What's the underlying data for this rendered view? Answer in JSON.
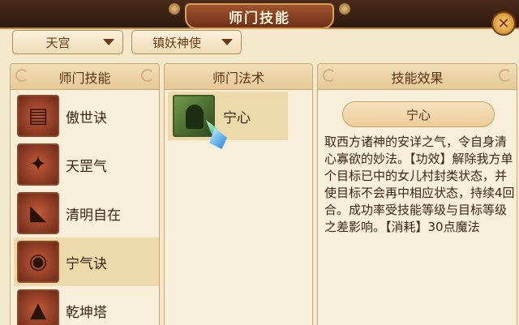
{
  "window": {
    "title": "师门技能",
    "close_glyph": "✕"
  },
  "filters": {
    "sect": "天宫",
    "master": "镇妖神使"
  },
  "panels": {
    "skills": {
      "header": "师门技能",
      "items": [
        {
          "name": "傲世诀",
          "icon": "scroll-icon",
          "glyph": "▤"
        },
        {
          "name": "天罡气",
          "icon": "warrior-icon",
          "glyph": "✦"
        },
        {
          "name": "清明自在",
          "icon": "horn-icon",
          "glyph": "◣"
        },
        {
          "name": "宁气诀",
          "icon": "orb-icon",
          "glyph": "◉"
        },
        {
          "name": "乾坤塔",
          "icon": "tower-icon",
          "glyph": "▲"
        }
      ],
      "selected_index": 3
    },
    "spells": {
      "header": "师门法术",
      "items": [
        {
          "name": "宁心",
          "icon": "meditating-figure-icon"
        }
      ]
    },
    "effect": {
      "header": "技能效果",
      "name": "宁心",
      "description": "取西方诸神的安详之气，令自身清心寡欲的妙法。【功效】解除我方单个目标已中的女儿村封类状态，并使目标不会再中相应状态，持续4回合。成功率受技能等级与目标等级之差影响。【消耗】30点魔法"
    }
  },
  "colors": {
    "accent": "#a0542d",
    "selected_row": "#eed9aa",
    "panel_bg": "#f8efdb"
  }
}
